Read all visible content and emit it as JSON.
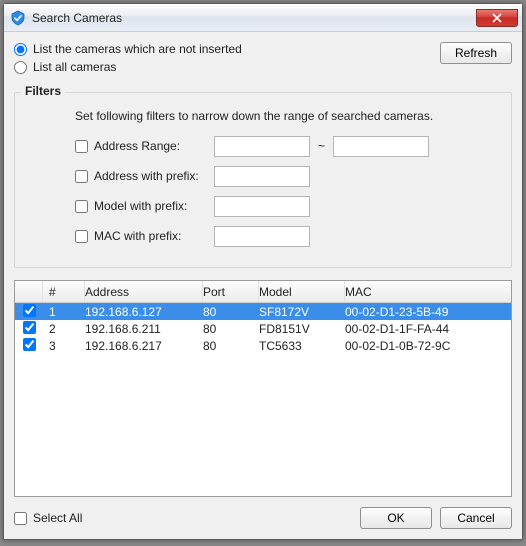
{
  "window": {
    "title": "Search Cameras"
  },
  "options": {
    "not_inserted_label": "List the cameras which are not inserted",
    "all_label": "List all cameras",
    "selected": "not_inserted"
  },
  "buttons": {
    "refresh": "Refresh",
    "ok": "OK",
    "cancel": "Cancel"
  },
  "filters": {
    "title": "Filters",
    "description": "Set following filters to narrow down the range of searched cameras.",
    "address_range_label": "Address Range:",
    "address_prefix_label": "Address with prefix:",
    "model_prefix_label": "Model with prefix:",
    "mac_prefix_label": "MAC with prefix:",
    "range_separator": "~",
    "address_range": {
      "enabled": false,
      "from": "",
      "to": ""
    },
    "address_prefix": {
      "enabled": false,
      "value": ""
    },
    "model_prefix": {
      "enabled": false,
      "value": ""
    },
    "mac_prefix": {
      "enabled": false,
      "value": ""
    }
  },
  "grid": {
    "headers": {
      "index": "#",
      "address": "Address",
      "port": "Port",
      "model": "Model",
      "mac": "MAC"
    },
    "rows": [
      {
        "checked": true,
        "selected": true,
        "index": "1",
        "address": "192.168.6.127",
        "port": "80",
        "model": "SF8172V",
        "mac": "00-02-D1-23-5B-49"
      },
      {
        "checked": true,
        "selected": false,
        "index": "2",
        "address": "192.168.6.211",
        "port": "80",
        "model": "FD8151V",
        "mac": "00-02-D1-1F-FA-44"
      },
      {
        "checked": true,
        "selected": false,
        "index": "3",
        "address": "192.168.6.217",
        "port": "80",
        "model": "TC5633",
        "mac": "00-02-D1-0B-72-9C"
      }
    ]
  },
  "footer": {
    "select_all_label": "Select All",
    "select_all_checked": false
  }
}
